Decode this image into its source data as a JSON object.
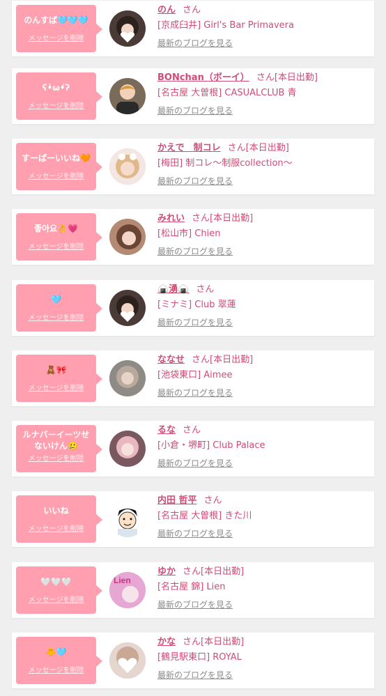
{
  "delete_label": "メッセージを削除",
  "blog_label": "最新のブログを見る",
  "san_label": "さん",
  "colors": {
    "bubble": "#ff9fb0",
    "name": "#d24b75",
    "link": "#8c8c8c",
    "background": "#efefef"
  },
  "items": [
    {
      "message": "のんすぱ🩵🩵🩵",
      "name": "のん",
      "status": "",
      "workplace": "[京成臼井] Girl's Bar Primavera",
      "avatar": "avatar-dark-hair"
    },
    {
      "message": "ʕ•̀ω•́ʔ",
      "name": "BONchan（ボーイ）",
      "status": "[本日出勤]",
      "workplace": "[名古屋 大曽根] CASUALCLUB 青",
      "avatar": "avatar-boy"
    },
    {
      "message": "すーぱーいいね🧡",
      "name": "かえで　制コレ",
      "status": "[本日出勤]",
      "workplace": "[梅田] 制コレ〜制服collection〜",
      "avatar": "avatar-blonde"
    },
    {
      "message": "좋아요👌💗",
      "name": "みれい",
      "status": "[本日出勤]",
      "workplace": "[松山市] Chien",
      "avatar": "avatar-brown-hair"
    },
    {
      "message": "🩵",
      "name": "🍙湧🍙",
      "status": "",
      "workplace": "[ミナミ] Club 翠蓮",
      "avatar": "avatar-dark-hair"
    },
    {
      "message": "🧸🎀",
      "name": "ななせ",
      "status": "[本日出勤]",
      "workplace": "[池袋東口] Aimee",
      "avatar": "avatar-blur"
    },
    {
      "message": "ルナバーイーツせないけん🥲",
      "name": "るな",
      "status": "",
      "workplace": "[小倉・堺町] Club Palace",
      "avatar": "avatar-pink"
    },
    {
      "message": "いいね",
      "name": "内田 哲平",
      "status": "",
      "workplace": "[名古屋 大曽根] きた川",
      "avatar": "avatar-illustration"
    },
    {
      "message": "🤍🤍🤍",
      "name": "ゆか",
      "status": "[本日出勤]",
      "workplace": "[名古屋 錦] Lien",
      "avatar": "avatar-lien"
    },
    {
      "message": "🐥🩵",
      "name": "かな",
      "status": "[本日出勤]",
      "workplace": "[鶴見駅東口] ROYAL",
      "avatar": "avatar-heart"
    }
  ]
}
